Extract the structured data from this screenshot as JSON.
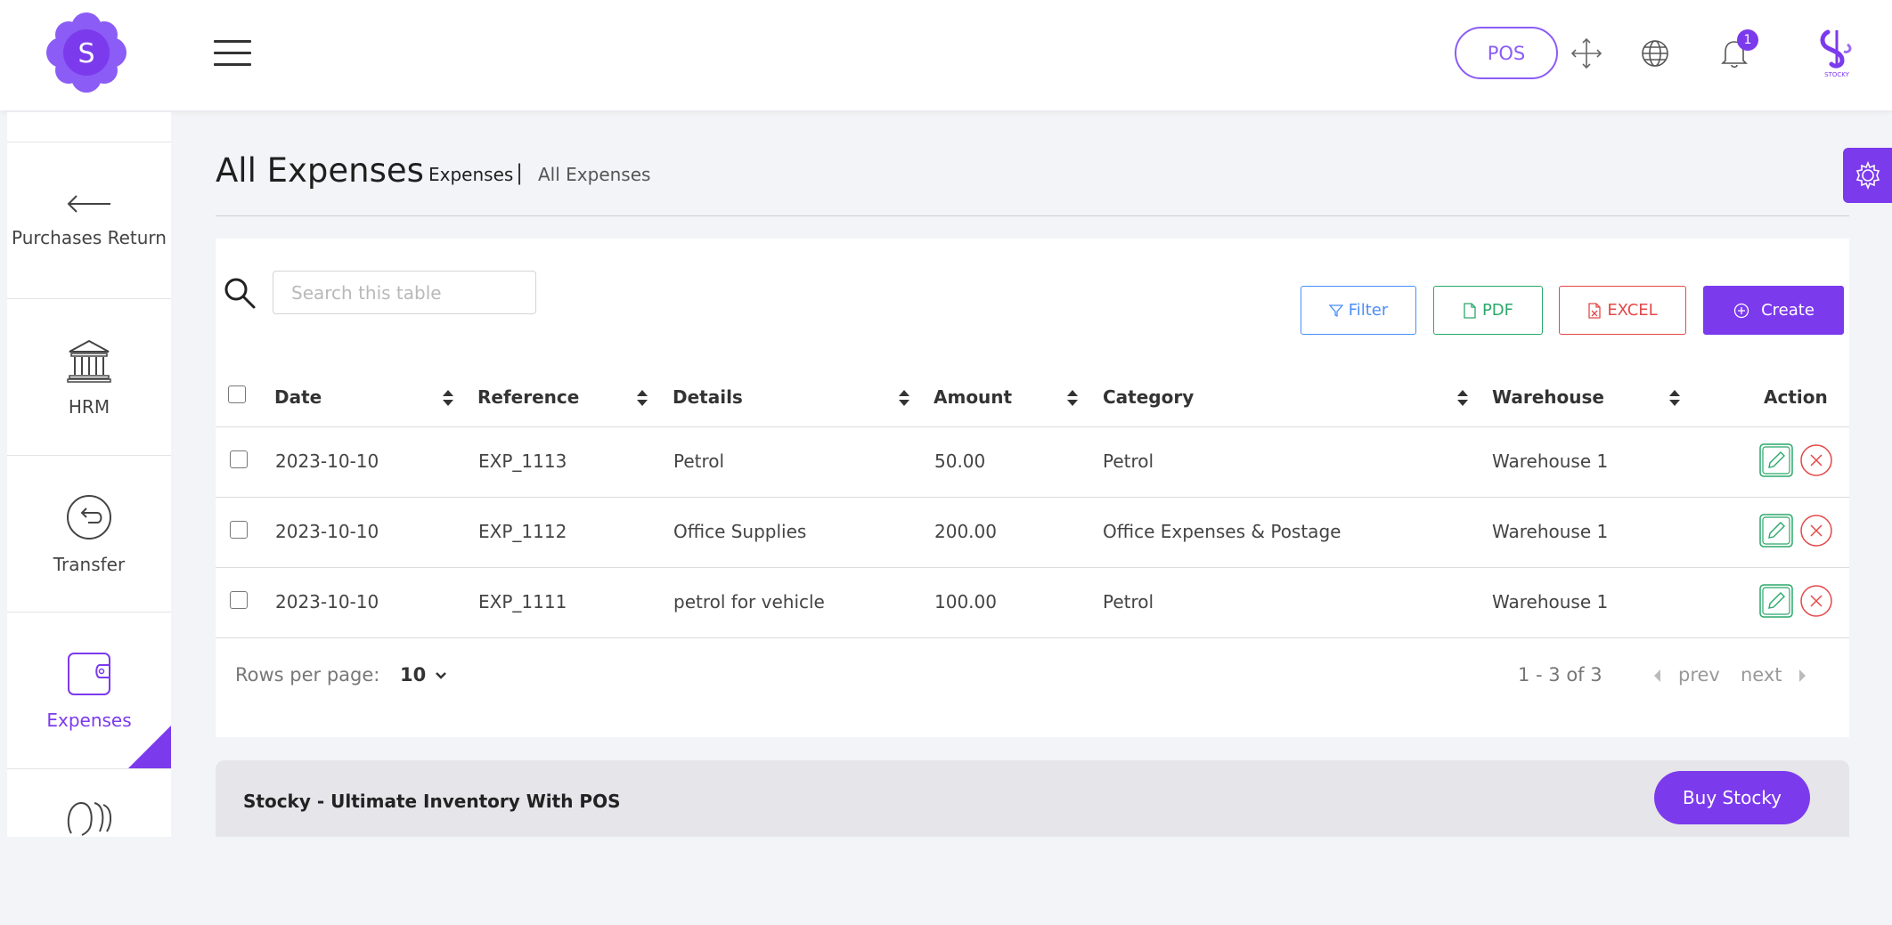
{
  "header": {
    "pos_label": "POS",
    "notification_count": "1",
    "brand_text": "STOCKY",
    "logo_letter": "S"
  },
  "sidebar": {
    "items": [
      {
        "label": "Purchases Return",
        "icon": "arrow-left-icon"
      },
      {
        "label": "HRM",
        "icon": "bank-icon"
      },
      {
        "label": "Transfer",
        "icon": "transfer-icon"
      },
      {
        "label": "Expenses",
        "icon": "wallet-icon",
        "active": true
      },
      {
        "label": "",
        "icon": "people-icon"
      }
    ]
  },
  "page": {
    "title": "All Expenses",
    "breadcrumb_parent": "Expenses",
    "breadcrumb_separator": "|",
    "breadcrumb_current": "All Expenses"
  },
  "toolbar": {
    "search_placeholder": "Search this table",
    "filter_label": "Filter",
    "pdf_label": "PDF",
    "excel_label": "EXCEL",
    "create_label": "Create"
  },
  "table": {
    "columns": [
      "Date",
      "Reference",
      "Details",
      "Amount",
      "Category",
      "Warehouse",
      "Action"
    ],
    "rows": [
      {
        "date": "2023-10-10",
        "reference": "EXP_1113",
        "details": "Petrol",
        "amount": "50.00",
        "category": "Petrol",
        "warehouse": "Warehouse 1"
      },
      {
        "date": "2023-10-10",
        "reference": "EXP_1112",
        "details": "Office Supplies",
        "amount": "200.00",
        "category": "Office Expenses & Postage",
        "warehouse": "Warehouse 1"
      },
      {
        "date": "2023-10-10",
        "reference": "EXP_1111",
        "details": "petrol for vehicle",
        "amount": "100.00",
        "category": "Petrol",
        "warehouse": "Warehouse 1"
      }
    ]
  },
  "pagination": {
    "rows_per_page_label": "Rows per page:",
    "rows_per_page_value": "10",
    "range_text": "1 - 3 of 3",
    "prev_label": "prev",
    "next_label": "next"
  },
  "footer": {
    "text": "Stocky - Ultimate Inventory With POS",
    "buy_label": "Buy Stocky"
  },
  "colors": {
    "accent": "#7c3aed",
    "filter": "#4a8ef7",
    "pdf": "#2ba86b",
    "excel": "#e44848"
  }
}
